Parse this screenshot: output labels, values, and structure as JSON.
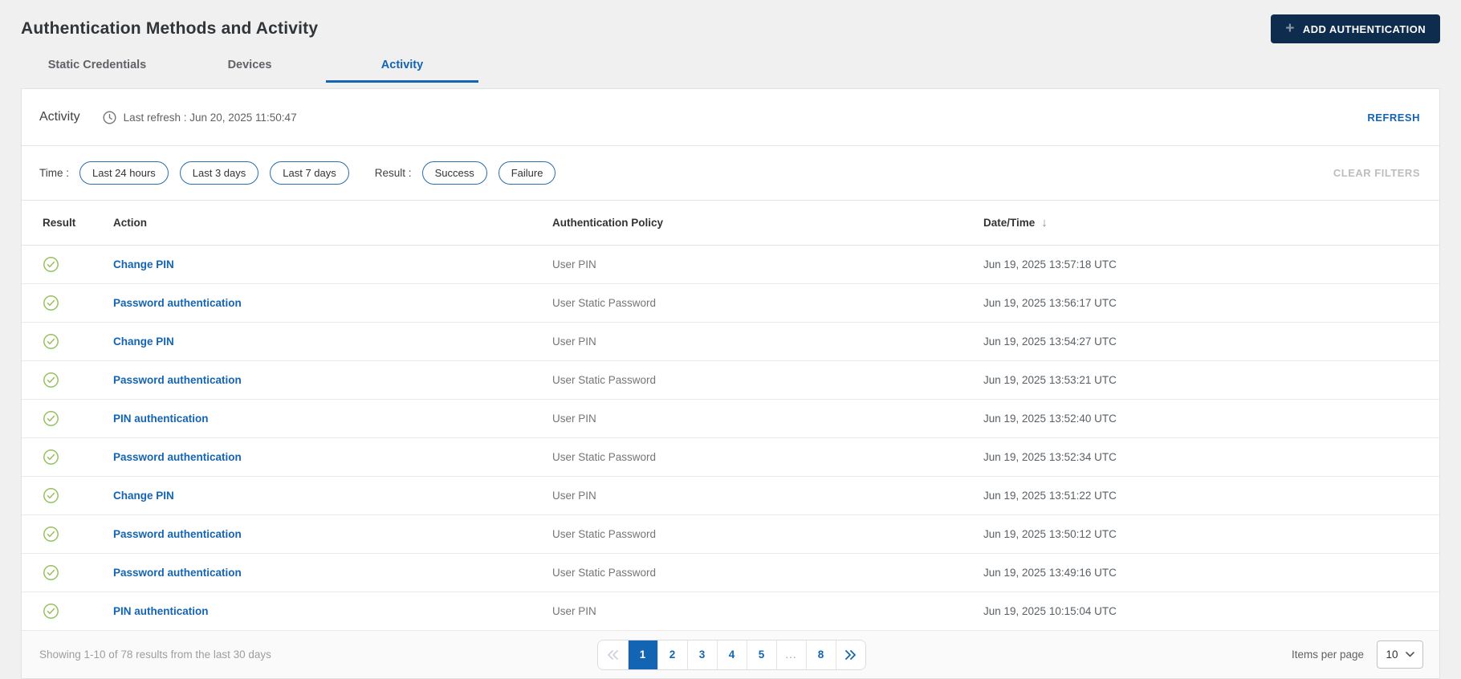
{
  "header": {
    "title": "Authentication Methods and Activity",
    "add_authentication_label": "ADD AUTHENTICATION"
  },
  "tabs": [
    {
      "label": "Static Credentials"
    },
    {
      "label": "Devices"
    },
    {
      "label": "Activity"
    }
  ],
  "active_tab": "Activity",
  "panel": {
    "title": "Activity",
    "last_refresh": "Last refresh : Jun 20, 2025 11:50:47",
    "refresh_label": "REFRESH"
  },
  "filters": {
    "time_label": "Time :",
    "time_options": [
      "Last 24 hours",
      "Last 3 days",
      "Last 7 days"
    ],
    "result_label": "Result :",
    "result_options": [
      "Success",
      "Failure"
    ],
    "clear_label": "CLEAR FILTERS"
  },
  "table": {
    "columns": {
      "result": "Result",
      "action": "Action",
      "policy": "Authentication Policy",
      "datetime": "Date/Time"
    },
    "sort": {
      "column": "Date/Time",
      "direction": "desc",
      "arrow": "↓"
    },
    "rows": [
      {
        "result": "success",
        "action": "Change PIN",
        "policy": "User PIN",
        "datetime": "Jun 19, 2025 13:57:18 UTC"
      },
      {
        "result": "success",
        "action": "Password authentication",
        "policy": "User Static Password",
        "datetime": "Jun 19, 2025 13:56:17 UTC"
      },
      {
        "result": "success",
        "action": "Change PIN",
        "policy": "User PIN",
        "datetime": "Jun 19, 2025 13:54:27 UTC"
      },
      {
        "result": "success",
        "action": "Password authentication",
        "policy": "User Static Password",
        "datetime": "Jun 19, 2025 13:53:21 UTC"
      },
      {
        "result": "success",
        "action": "PIN authentication",
        "policy": "User PIN",
        "datetime": "Jun 19, 2025 13:52:40 UTC"
      },
      {
        "result": "success",
        "action": "Password authentication",
        "policy": "User Static Password",
        "datetime": "Jun 19, 2025 13:52:34 UTC"
      },
      {
        "result": "success",
        "action": "Change PIN",
        "policy": "User PIN",
        "datetime": "Jun 19, 2025 13:51:22 UTC"
      },
      {
        "result": "success",
        "action": "Password authentication",
        "policy": "User Static Password",
        "datetime": "Jun 19, 2025 13:50:12 UTC"
      },
      {
        "result": "success",
        "action": "Password authentication",
        "policy": "User Static Password",
        "datetime": "Jun 19, 2025 13:49:16 UTC"
      },
      {
        "result": "success",
        "action": "PIN authentication",
        "policy": "User PIN",
        "datetime": "Jun 19, 2025 10:15:04 UTC"
      }
    ]
  },
  "footer": {
    "summary": "Showing 1-10 of 78 results from the last 30 days",
    "pagination": {
      "pages": [
        "1",
        "2",
        "3",
        "4",
        "5",
        "...",
        "8"
      ],
      "active_page": "1"
    },
    "items_per_page_label": "Items per page",
    "items_per_page_value": "10"
  },
  "colors": {
    "accent_blue": "#1464b4",
    "primary_button_navy": "#0d2c4e",
    "success_green": "#97c15c"
  }
}
